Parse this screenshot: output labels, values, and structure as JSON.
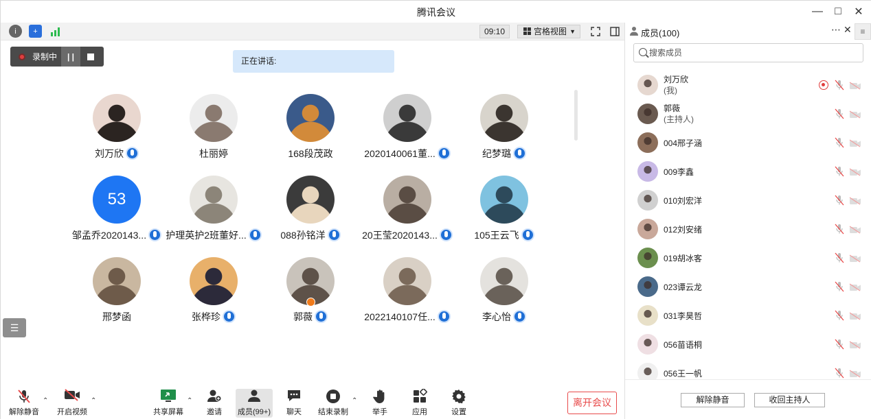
{
  "window": {
    "title": "腾讯会议"
  },
  "topbar": {
    "time": "09:10",
    "view_label": "宫格视图"
  },
  "stage": {
    "recording_label": "录制中",
    "speaking_label": "正在讲话:",
    "tiles": [
      {
        "name": "刘万欣",
        "mic": true,
        "avatar": "photo"
      },
      {
        "name": "杜丽婷",
        "mic": false,
        "avatar": "photo"
      },
      {
        "name": "168段茂政",
        "mic": false,
        "avatar": "photo"
      },
      {
        "name": "2020140061董...",
        "mic": true,
        "avatar": "photo"
      },
      {
        "name": "纪梦璐",
        "mic": true,
        "avatar": "photo"
      },
      {
        "name": "邹孟乔2020143...",
        "mic": true,
        "avatar": "number",
        "avatar_text": "53"
      },
      {
        "name": "护理英护2班董好...",
        "mic": true,
        "avatar": "photo"
      },
      {
        "name": "088孙铭洋",
        "mic": true,
        "avatar": "photo"
      },
      {
        "name": "20王莹2020143...",
        "mic": true,
        "avatar": "photo"
      },
      {
        "name": "105王云飞",
        "mic": true,
        "avatar": "photo"
      },
      {
        "name": "邢梦函",
        "mic": false,
        "avatar": "photo"
      },
      {
        "name": "张桦珍",
        "mic": true,
        "avatar": "photo"
      },
      {
        "name": "郭薇",
        "mic": true,
        "avatar": "photo",
        "host": true
      },
      {
        "name": "2022140107任...",
        "mic": true,
        "avatar": "photo"
      },
      {
        "name": "李心怡",
        "mic": true,
        "avatar": "photo"
      }
    ]
  },
  "bottombar": {
    "unmute": "解除静音",
    "start_video": "开启视频",
    "share_screen": "共享屏幕",
    "invite": "邀请",
    "members": "成员(99+)",
    "chat": "聊天",
    "end_recording": "结束录制",
    "raise_hand": "举手",
    "apps": "应用",
    "settings": "设置",
    "leave": "离开会议"
  },
  "panel": {
    "title": "成员(100)",
    "search_placeholder": "搜索成员",
    "members": [
      {
        "name": "刘万欣",
        "sub": "(我)",
        "recording": true
      },
      {
        "name": "郭薇",
        "sub": "(主持人)"
      },
      {
        "name": "004邢子涵"
      },
      {
        "name": "009李鑫"
      },
      {
        "name": "010刘宏洋"
      },
      {
        "name": "012刘安绪"
      },
      {
        "name": "019胡冰客"
      },
      {
        "name": "023谭云龙"
      },
      {
        "name": "031李昊哲"
      },
      {
        "name": "056苗语桐"
      },
      {
        "name": "056王一帆"
      }
    ],
    "unmute_all": "解除静音",
    "reclaim_host": "收回主持人"
  }
}
